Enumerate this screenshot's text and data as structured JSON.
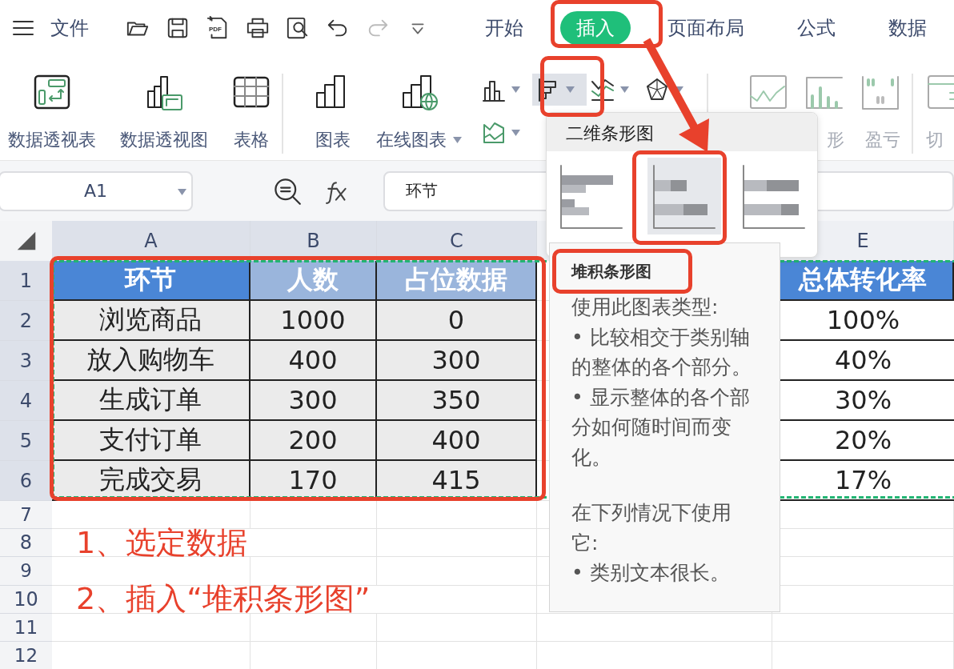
{
  "menu_bar": {
    "file_label": "文件",
    "tools": [
      {
        "kind": "open",
        "disabled": false
      },
      {
        "kind": "save",
        "disabled": false
      },
      {
        "kind": "pdf",
        "label": "PDF",
        "disabled": false
      },
      {
        "kind": "print",
        "disabled": false
      },
      {
        "kind": "preview",
        "disabled": false
      },
      {
        "kind": "undo",
        "disabled": false
      },
      {
        "kind": "redo",
        "disabled": true
      },
      {
        "kind": "more",
        "disabled": false
      }
    ],
    "tabs": [
      {
        "label": "开始",
        "selected": false
      },
      {
        "label": "插入",
        "selected": true
      },
      {
        "label": "页面布局",
        "selected": false
      },
      {
        "label": "公式",
        "selected": false
      },
      {
        "label": "数据",
        "selected": false
      }
    ]
  },
  "ribbon": {
    "big_buttons": [
      {
        "kind": "pivot-table",
        "label": "数据透视表"
      },
      {
        "kind": "pivot-chart",
        "label": "数据透视图"
      },
      {
        "kind": "table",
        "label": "表格"
      },
      {
        "kind": "chart",
        "label": "图表",
        "divider_before": true
      },
      {
        "kind": "online-chart",
        "label": "在线图表",
        "has_menu": true
      }
    ],
    "chart_types": [
      {
        "kind": "column",
        "selected": false
      },
      {
        "kind": "bar",
        "selected": true
      },
      {
        "kind": "line",
        "selected": false
      },
      {
        "kind": "radar",
        "selected": false
      },
      {
        "kind": "area",
        "selected": false
      }
    ],
    "sparklines": [
      {
        "kind": "line"
      },
      {
        "kind": "column",
        "label": "形"
      },
      {
        "kind": "winloss",
        "label": "盈亏"
      }
    ],
    "slicer": {
      "label": "切"
    }
  },
  "formula_bar": {
    "name_box": "A1",
    "formula": "环节"
  },
  "sheet": {
    "columns": [
      {
        "label": "A",
        "selected": true
      },
      {
        "label": "B",
        "selected": true
      },
      {
        "label": "C",
        "selected": true
      },
      {
        "selected": false
      },
      {
        "label": "E",
        "selected": false
      }
    ],
    "rows": [
      {
        "number": "1",
        "kind": "header",
        "selected": true,
        "cells": [
          {
            "text": "环节",
            "selected": false
          },
          {
            "text": "人数",
            "selected": true
          },
          {
            "text": "占位数据",
            "selected": true
          },
          null,
          {
            "text": "总体转化率",
            "selected": false
          }
        ]
      },
      {
        "number": "2",
        "kind": "data",
        "selected": true,
        "cells": [
          {
            "text": "浏览商品",
            "selected": true
          },
          {
            "text": "1000",
            "selected": true
          },
          {
            "text": "0",
            "selected": true
          },
          null,
          {
            "text": "100%",
            "selected": false
          }
        ]
      },
      {
        "number": "3",
        "kind": "data",
        "selected": true,
        "cells": [
          {
            "text": "放入购物车",
            "selected": true
          },
          {
            "text": "400",
            "selected": true
          },
          {
            "text": "300",
            "selected": true
          },
          null,
          {
            "text": "40%",
            "selected": false
          }
        ]
      },
      {
        "number": "4",
        "kind": "data",
        "selected": true,
        "cells": [
          {
            "text": "生成订单",
            "selected": true
          },
          {
            "text": "300",
            "selected": true
          },
          {
            "text": "350",
            "selected": true
          },
          null,
          {
            "text": "30%",
            "selected": false
          }
        ]
      },
      {
        "number": "5",
        "kind": "data",
        "selected": true,
        "cells": [
          {
            "text": "支付订单",
            "selected": true
          },
          {
            "text": "200",
            "selected": true
          },
          {
            "text": "400",
            "selected": true
          },
          null,
          {
            "text": "20%",
            "selected": false
          }
        ]
      },
      {
        "number": "6",
        "kind": "data",
        "selected": true,
        "cells": [
          {
            "text": "完成交易",
            "selected": true
          },
          {
            "text": "170",
            "selected": true
          },
          {
            "text": "415",
            "selected": true
          },
          null,
          {
            "text": "17%",
            "selected": false
          }
        ]
      },
      {
        "number": "7",
        "kind": "empty",
        "selected": false
      },
      {
        "number": "8",
        "kind": "note",
        "selected": false,
        "cells": [
          {
            "text": "1、选定数据"
          },
          null
        ]
      },
      {
        "number": "9",
        "kind": "empty",
        "selected": false
      },
      {
        "number": "10",
        "kind": "note",
        "selected": false,
        "cells": [
          {
            "text": "2、插入“堆积条形图”"
          },
          null,
          null
        ]
      },
      {
        "number": "11",
        "kind": "empty",
        "selected": false
      },
      {
        "number": "12",
        "kind": "empty",
        "selected": false
      }
    ]
  },
  "chart_menu": {
    "title": "二维条形图",
    "options": [
      {
        "kind": "clustered",
        "selected": false
      },
      {
        "kind": "stacked",
        "selected": true
      },
      {
        "kind": "percent",
        "selected": false
      }
    ]
  },
  "tooltip": {
    "title": "堆积条形图",
    "items": [
      {
        "kind": "heading",
        "text": "使用此图表类型:"
      },
      {
        "kind": "bullet",
        "text": "• 比较相交于类别轴的整体的各个部分。"
      },
      {
        "kind": "bullet",
        "text": "• 显示整体的各个部分如何随时间而变化。"
      },
      {
        "kind": "heading",
        "text": "在下列情况下使用它:"
      },
      {
        "kind": "bullet",
        "text": "• 类别文本很长。"
      }
    ]
  }
}
